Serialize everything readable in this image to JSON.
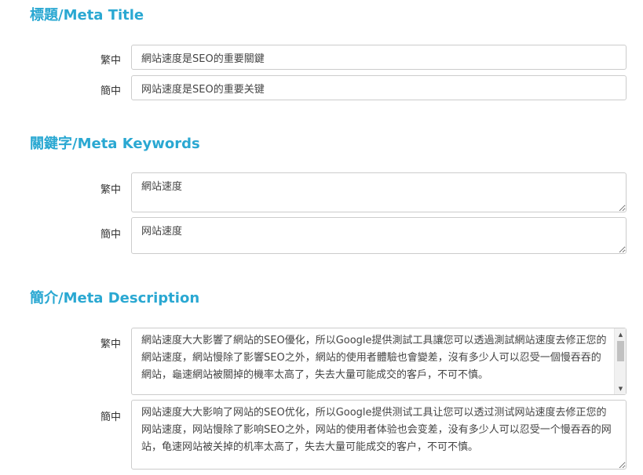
{
  "sections": {
    "title": {
      "heading": "標題/Meta Title",
      "traditional": {
        "label": "繁中",
        "value": "網站速度是SEO的重要關鍵"
      },
      "simplified": {
        "label": "簡中",
        "value": "网站速度是SEO的重要关键"
      }
    },
    "keywords": {
      "heading": "關鍵字/Meta Keywords",
      "traditional": {
        "label": "繁中",
        "value": "網站速度"
      },
      "simplified": {
        "label": "簡中",
        "value": "网站速度"
      }
    },
    "description": {
      "heading": "簡介/Meta Description",
      "traditional": {
        "label": "繁中",
        "value": "網站速度大大影響了網站的SEO優化，所以Google提供測試工具讓您可以透過測試網站速度去修正您的網站速度，網站慢除了影響SEO之外，網站的使用者體驗也會變差，沒有多少人可以忍受一個慢吞吞的網站，龜速網站被關掉的機率太高了，失去大量可能成交的客戶，不可不慎。"
      },
      "simplified": {
        "label": "簡中",
        "value": "网站速度大大影响了网站的SEO优化，所以Google提供测试工具让您可以透过测试网站速度去修正您的网站速度，网站慢除了影响SEO之外，网站的使用者体验也会变差，没有多少人可以忍受一个慢吞吞的网站，龟速网站被关掉的机率太高了，失去大量可能成交的客户，不可不慎。"
      }
    }
  },
  "icons": {
    "scroll_up": "arrow-up-icon",
    "scroll_down": "arrow-down-icon",
    "resize": "resize-grip-icon"
  }
}
